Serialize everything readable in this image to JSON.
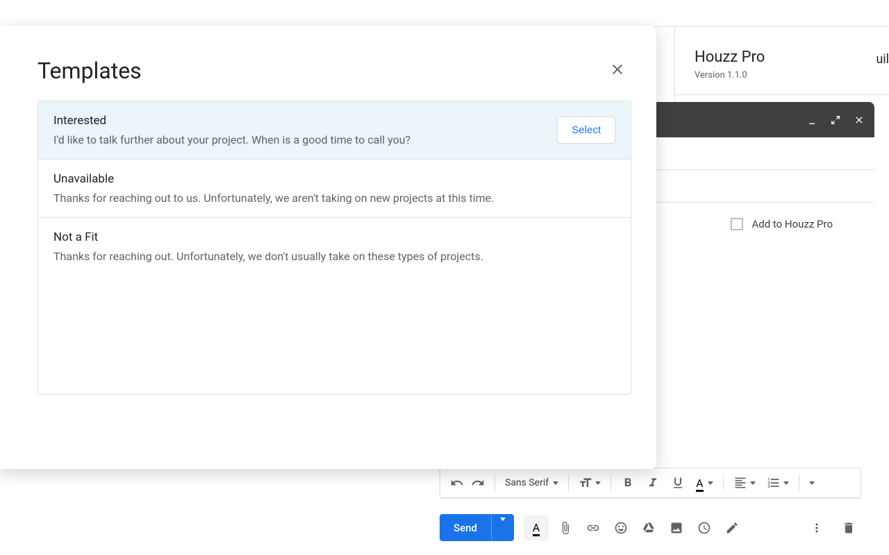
{
  "right_panel": {
    "title": "Houzz Pro",
    "version": "Version 1.1.0"
  },
  "compose": {
    "add_label": "Add to Houzz Pro",
    "peek_text": "uil",
    "font_label": "Sans Serif",
    "send_label": "Send"
  },
  "modal": {
    "title": "Templates",
    "select_label": "Select",
    "templates": [
      {
        "name": "Interested",
        "preview": "I'd like to talk further about your project. When is a good time to call you?",
        "selected": true
      },
      {
        "name": "Unavailable",
        "preview": "Thanks for reaching out to us. Unfortunately, we aren't taking on new projects at this time.",
        "selected": false
      },
      {
        "name": "Not a Fit",
        "preview": "Thanks for reaching out. Unfortunately, we don't usually take on these types of projects.",
        "selected": false
      }
    ]
  }
}
